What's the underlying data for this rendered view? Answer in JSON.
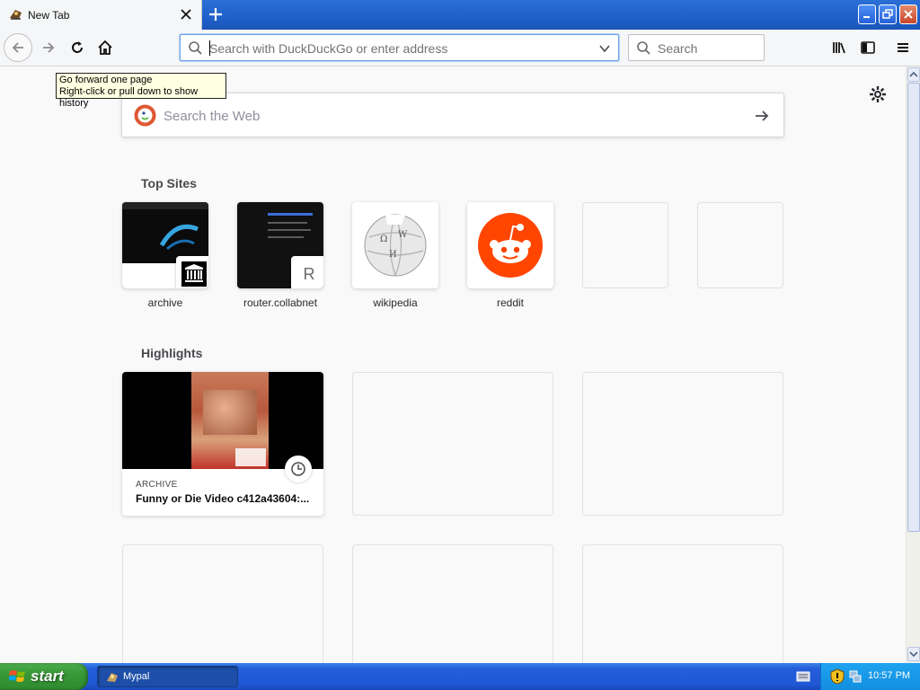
{
  "window": {
    "tab_title": "New Tab",
    "taskbar_app": "Mypal"
  },
  "navbar": {
    "url_placeholder": "Search with DuckDuckGo or enter address",
    "search_placeholder": "Search"
  },
  "tooltip": {
    "line1": "Go forward one page",
    "line2": "Right-click or pull down to show history"
  },
  "content": {
    "web_search_placeholder": "Search the Web",
    "top_sites_title": "Top Sites",
    "top_sites": [
      {
        "label": "archive",
        "icon": "archive-building-icon"
      },
      {
        "label": "router.collabnet",
        "icon": "letter-r-icon",
        "letter": "R"
      },
      {
        "label": "wikipedia",
        "icon": "wikipedia-globe-icon"
      },
      {
        "label": "reddit",
        "icon": "reddit-alien-icon"
      },
      {
        "label": ""
      },
      {
        "label": ""
      }
    ],
    "highlights_title": "Highlights",
    "highlights": [
      {
        "source": "ARCHIVE",
        "title": "Funny or Die Video c412a43604:..."
      }
    ]
  },
  "taskbar": {
    "start_label": "start",
    "clock": "10:57 PM"
  },
  "colors": {
    "accent": "#0a84ff",
    "reddit": "#ff4500",
    "duckduckgo": "#de5833",
    "xp_taskbar": "#245edb",
    "tooltip_bg": "#ffffe1"
  }
}
